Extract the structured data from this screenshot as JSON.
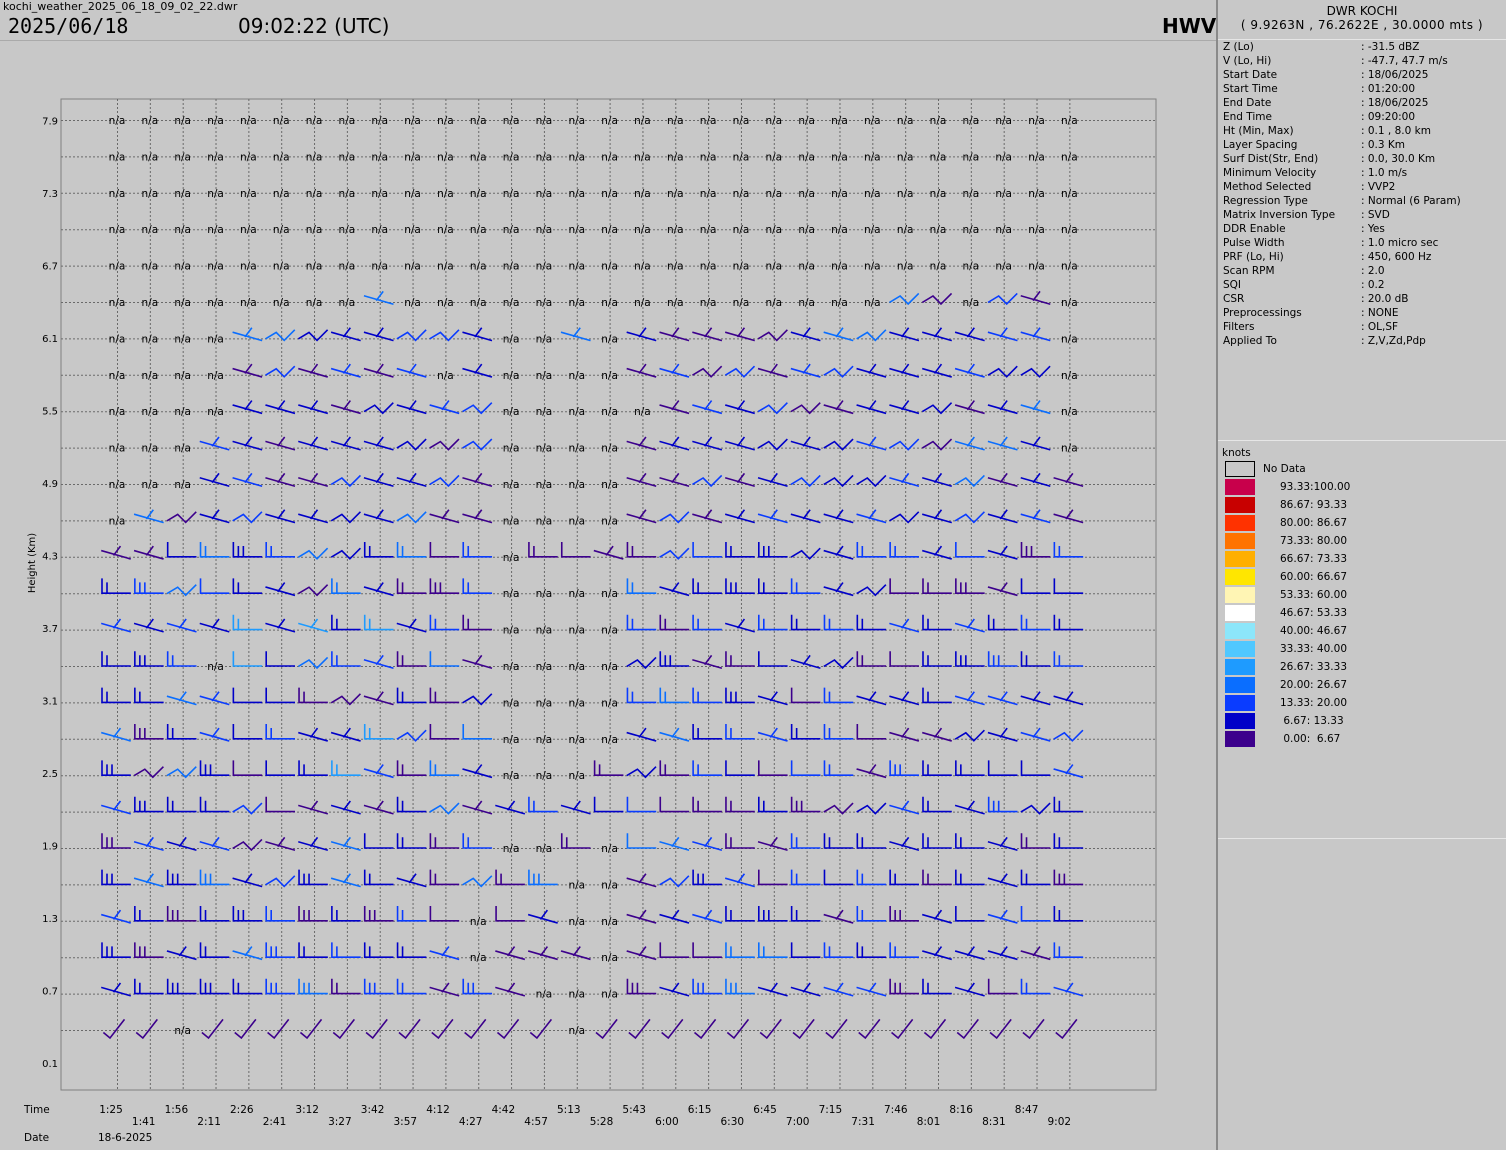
{
  "file_name": "kochi_weather_2025_06_18_09_02_22.dwr",
  "header": {
    "date": "2025/06/18",
    "time": "09:02:22 (UTC)",
    "product": "HWV"
  },
  "station": {
    "name": "DWR KOCHI",
    "coords": "( 9.9263N , 76.2622E , 30.0000 mts )"
  },
  "info": [
    {
      "key": "Z (Lo)",
      "value": ": -31.5 dBZ"
    },
    {
      "key": "V (Lo, Hi)",
      "value": ": -47.7, 47.7 m/s"
    },
    {
      "key": "Start Date",
      "value": ": 18/06/2025"
    },
    {
      "key": "Start Time",
      "value": ": 01:20:00"
    },
    {
      "key": "End Date",
      "value": ": 18/06/2025"
    },
    {
      "key": "End Time",
      "value": ": 09:20:00"
    },
    {
      "key": "Ht (Min, Max)",
      "value": ": 0.1 , 8.0 km"
    },
    {
      "key": "Layer Spacing",
      "value": ": 0.3 Km"
    },
    {
      "key": "Surf Dist(Str, End)",
      "value": ": 0.0, 30.0 Km"
    },
    {
      "key": "Minimum Velocity",
      "value": ": 1.0 m/s"
    },
    {
      "key": "Method Selected",
      "value": ": VVP2"
    },
    {
      "key": "Regression Type",
      "value": ": Normal (6 Param)"
    },
    {
      "key": "Matrix Inversion Type",
      "value": ": SVD"
    },
    {
      "key": "DDR Enable",
      "value": ": Yes"
    },
    {
      "key": "Pulse Width",
      "value": ": 1.0 micro sec"
    },
    {
      "key": "PRF (Lo, Hi)",
      "value": ": 450, 600 Hz"
    },
    {
      "key": "Scan RPM",
      "value": ": 2.0"
    },
    {
      "key": "SQI",
      "value": ": 0.2"
    },
    {
      "key": "CSR",
      "value": ": 20.0 dB"
    },
    {
      "key": "Preprocessings",
      "value": ": NONE"
    },
    {
      "key": "Filters",
      "value": ": OL,SF"
    },
    {
      "key": "Applied To",
      "value": ": Z,V,Zd,Pdp"
    }
  ],
  "legend": {
    "title": "knots",
    "no_data": "No Data",
    "no_data_color": "#c8c8c8",
    "entries": [
      {
        "label": "93.33:100.00",
        "color": "#c8004b"
      },
      {
        "label": "86.67: 93.33",
        "color": "#c80000"
      },
      {
        "label": "80.00: 86.67",
        "color": "#ff3200"
      },
      {
        "label": "73.33: 80.00",
        "color": "#ff7300"
      },
      {
        "label": "66.67: 73.33",
        "color": "#ffaf00"
      },
      {
        "label": "60.00: 66.67",
        "color": "#ffe600"
      },
      {
        "label": "53.33: 60.00",
        "color": "#fff5b4"
      },
      {
        "label": "46.67: 53.33",
        "color": "#ffffff"
      },
      {
        "label": "40.00: 46.67",
        "color": "#8ce6fa"
      },
      {
        "label": "33.33: 40.00",
        "color": "#50c8ff"
      },
      {
        "label": "26.67: 33.33",
        "color": "#1e9bff"
      },
      {
        "label": "20.00: 26.67",
        "color": "#0a6eff"
      },
      {
        "label": "13.33: 20.00",
        "color": "#0a3cff"
      },
      {
        "label": " 6.67: 13.33",
        "color": "#0000c8"
      },
      {
        "label": " 0.00:  6.67",
        "color": "#3c008c"
      }
    ]
  },
  "chart_data": {
    "type": "wind-barb time-height",
    "ylabel": "Height (Km)",
    "y_ticks": [
      "0.1",
      "0.7",
      "1.3",
      "1.9",
      "2.5",
      "3.1",
      "3.7",
      "4.3",
      "4.9",
      "5.5",
      "6.1",
      "6.7",
      "7.3",
      "7.9"
    ],
    "y_levels_km": [
      0.4,
      0.7,
      1.0,
      1.3,
      1.6,
      1.9,
      2.2,
      2.5,
      2.8,
      3.1,
      3.4,
      3.7,
      4.0,
      4.3,
      4.6,
      4.9,
      5.2,
      5.5,
      5.8,
      6.1,
      6.4,
      6.7,
      7.0,
      7.3,
      7.6,
      7.9
    ],
    "xlabel": "Time",
    "date_label": "Date",
    "date": "18-6-2025",
    "times": [
      "1:25",
      "1:41",
      "1:56",
      "2:11",
      "2:26",
      "2:41",
      "3:12",
      "3:27",
      "3:42",
      "3:57",
      "4:12",
      "4:27",
      "4:42",
      "4:57",
      "5:13",
      "5:28",
      "5:43",
      "6:00",
      "6:15",
      "6:30",
      "6:45",
      "7:00",
      "7:15",
      "7:31",
      "7:46",
      "8:01",
      "8:16",
      "8:31",
      "8:47",
      "9:02"
    ],
    "na_text": "n/a",
    "na_top_levels": 5,
    "missing": [
      [
        2,
        0
      ],
      [
        14,
        0
      ],
      [
        13,
        1
      ],
      [
        14,
        1
      ],
      [
        15,
        1
      ],
      [
        11,
        2
      ],
      [
        15,
        2
      ],
      [
        11,
        3
      ],
      [
        14,
        3
      ],
      [
        15,
        3
      ],
      [
        14,
        4
      ],
      [
        15,
        4
      ],
      [
        12,
        5
      ],
      [
        13,
        5
      ],
      [
        15,
        5
      ],
      [
        12,
        7
      ],
      [
        13,
        7
      ],
      [
        14,
        7
      ],
      [
        12,
        8
      ],
      [
        13,
        8
      ],
      [
        14,
        8
      ],
      [
        15,
        8
      ],
      [
        12,
        9
      ],
      [
        13,
        9
      ],
      [
        14,
        9
      ],
      [
        15,
        9
      ],
      [
        3,
        10
      ],
      [
        12,
        10
      ],
      [
        13,
        10
      ],
      [
        14,
        10
      ],
      [
        15,
        10
      ],
      [
        12,
        11
      ],
      [
        13,
        11
      ],
      [
        14,
        11
      ],
      [
        15,
        11
      ],
      [
        12,
        12
      ],
      [
        13,
        12
      ],
      [
        14,
        12
      ],
      [
        15,
        12
      ],
      [
        12,
        13
      ],
      [
        0,
        14
      ],
      [
        12,
        14
      ],
      [
        13,
        14
      ],
      [
        14,
        14
      ],
      [
        15,
        14
      ],
      [
        0,
        15
      ],
      [
        1,
        15
      ],
      [
        2,
        15
      ],
      [
        12,
        15
      ],
      [
        13,
        15
      ],
      [
        14,
        15
      ],
      [
        15,
        15
      ],
      [
        0,
        16
      ],
      [
        1,
        16
      ],
      [
        2,
        16
      ],
      [
        12,
        16
      ],
      [
        13,
        16
      ],
      [
        14,
        16
      ],
      [
        15,
        16
      ],
      [
        29,
        16
      ],
      [
        0,
        17
      ],
      [
        1,
        17
      ],
      [
        2,
        17
      ],
      [
        3,
        17
      ],
      [
        12,
        17
      ],
      [
        13,
        17
      ],
      [
        14,
        17
      ],
      [
        15,
        17
      ],
      [
        16,
        17
      ],
      [
        29,
        17
      ],
      [
        0,
        18
      ],
      [
        1,
        18
      ],
      [
        2,
        18
      ],
      [
        3,
        18
      ],
      [
        10,
        18
      ],
      [
        12,
        18
      ],
      [
        13,
        18
      ],
      [
        14,
        18
      ],
      [
        15,
        18
      ],
      [
        29,
        18
      ],
      [
        0,
        19
      ],
      [
        1,
        19
      ],
      [
        2,
        19
      ],
      [
        3,
        19
      ],
      [
        12,
        19
      ],
      [
        13,
        19
      ],
      [
        15,
        19
      ],
      [
        29,
        19
      ],
      [
        0,
        20
      ],
      [
        1,
        20
      ],
      [
        2,
        20
      ],
      [
        3,
        20
      ],
      [
        4,
        20
      ],
      [
        5,
        20
      ],
      [
        6,
        20
      ],
      [
        7,
        20
      ],
      [
        9,
        20
      ],
      [
        10,
        20
      ],
      [
        11,
        20
      ],
      [
        12,
        20
      ],
      [
        13,
        20
      ],
      [
        14,
        20
      ],
      [
        15,
        20
      ],
      [
        16,
        20
      ],
      [
        17,
        20
      ],
      [
        18,
        20
      ],
      [
        19,
        20
      ],
      [
        20,
        20
      ],
      [
        21,
        20
      ],
      [
        22,
        20
      ],
      [
        23,
        20
      ],
      [
        26,
        20
      ],
      [
        29,
        20
      ]
    ],
    "ylim_km": [
      0.1,
      8.0
    ],
    "grid": true
  }
}
